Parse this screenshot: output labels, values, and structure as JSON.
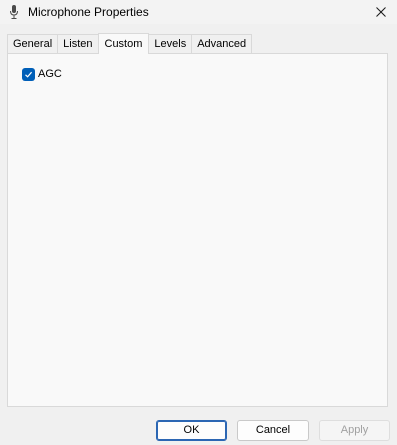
{
  "window": {
    "title": "Microphone Properties",
    "icon": "microphone-icon",
    "close_icon": "close-icon"
  },
  "tabs": [
    {
      "label": "General",
      "active": false
    },
    {
      "label": "Listen",
      "active": false
    },
    {
      "label": "Custom",
      "active": true
    },
    {
      "label": "Levels",
      "active": false
    },
    {
      "label": "Advanced",
      "active": false
    }
  ],
  "custom": {
    "agc_label": "AGC",
    "agc_checked": true
  },
  "buttons": {
    "ok": "OK",
    "cancel": "Cancel",
    "apply": "Apply"
  },
  "colors": {
    "accent": "#005fb8",
    "panel_bg": "#f9f9f9",
    "window_bg": "#f0f0f0"
  }
}
